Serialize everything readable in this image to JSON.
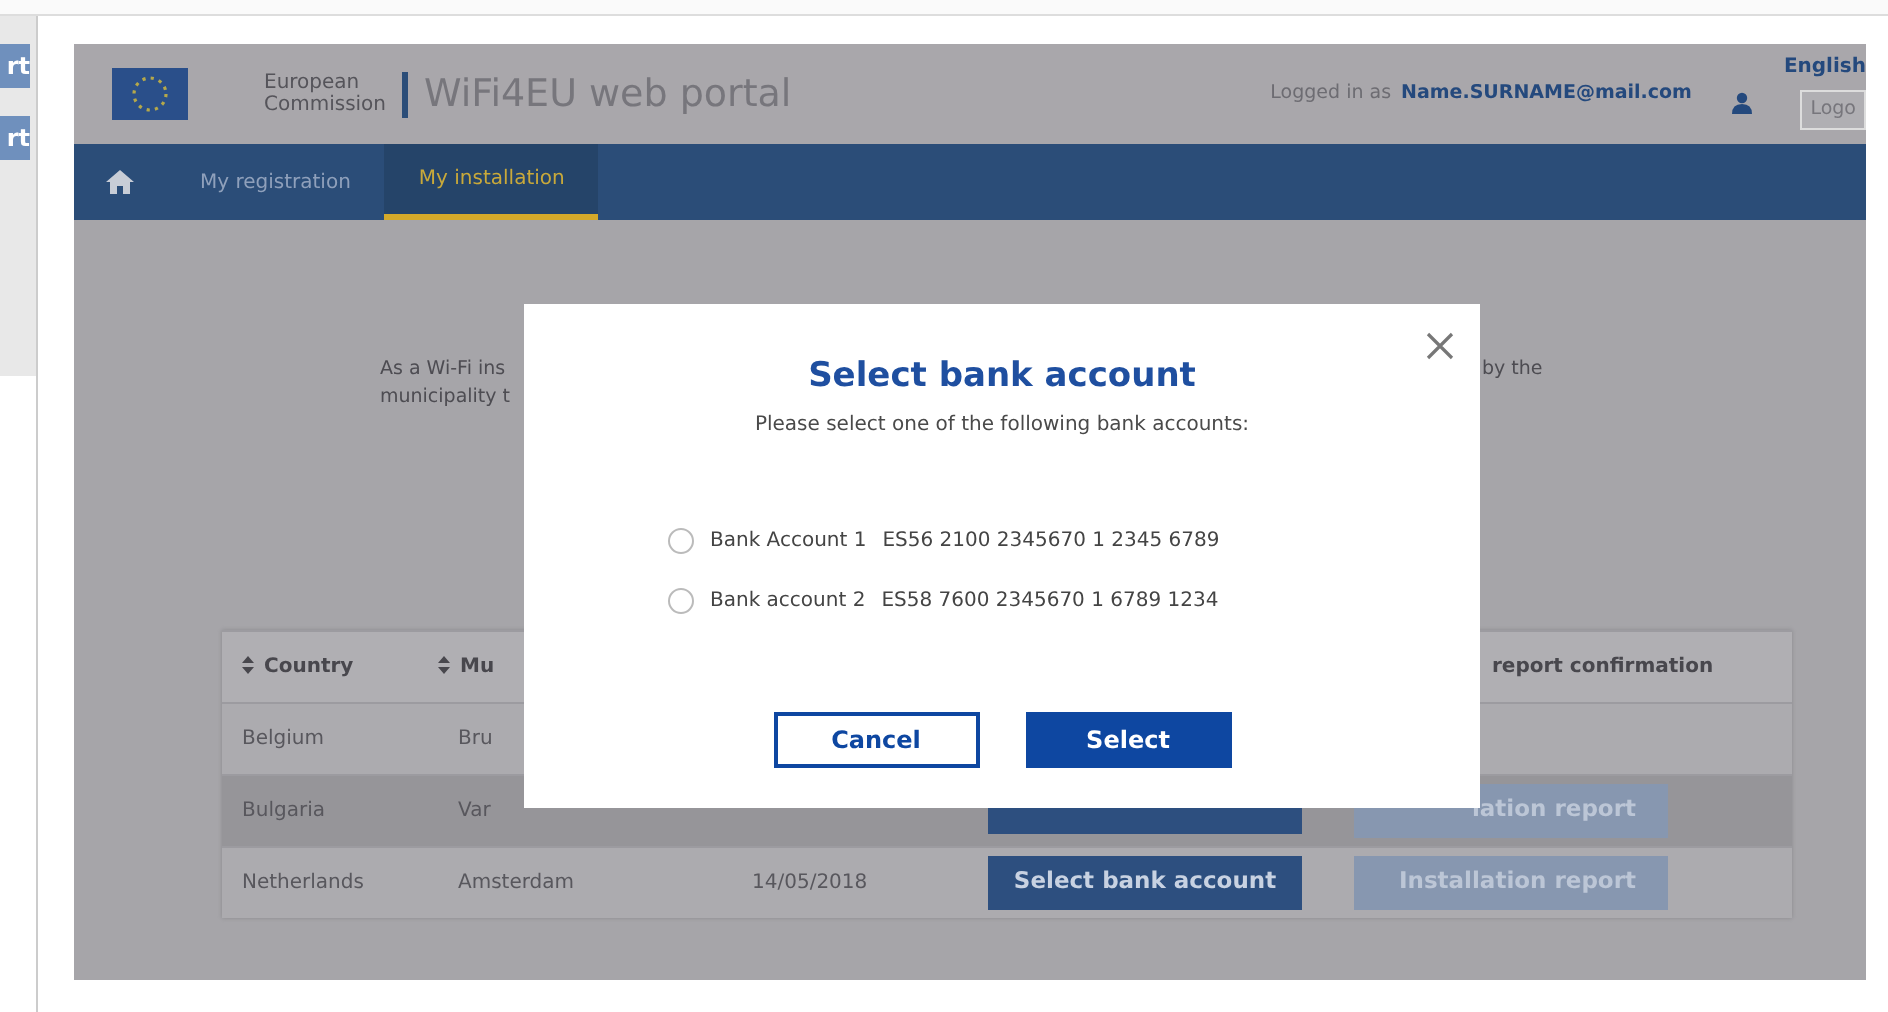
{
  "background_window": {
    "buttons": [
      "rt",
      "rt"
    ]
  },
  "header": {
    "organisation": "European Commission",
    "portal_title": "WiFi4EU web portal",
    "logged_in_label": "Logged in as",
    "user": "Name.SURNAME@mail.com",
    "language": "English",
    "logout": "Logo"
  },
  "nav": [
    {
      "kind": "home",
      "selected": false
    },
    {
      "kind": "link",
      "label": "My registration",
      "selected": false
    },
    {
      "kind": "link",
      "label": "My installation",
      "selected": true
    }
  ],
  "intro": {
    "lines": [
      "As a Wi-Fi ins",
      "municipality t"
    ],
    "right": "by the"
  },
  "table": {
    "columns": [
      {
        "label": "Country",
        "sortable": true
      },
      {
        "label": "Mu",
        "sortable": true
      },
      {
        "label": "report confirmation",
        "sortable": false
      }
    ],
    "rows": [
      {
        "country": "Belgium",
        "municipality": "Bru",
        "selected": false,
        "actions": []
      },
      {
        "country": "Bulgaria",
        "municipality": "Var",
        "selected": true,
        "actions": [
          {
            "kind": "select"
          },
          {
            "kind": "report",
            "label": "lation report"
          }
        ]
      },
      {
        "country": "Netherlands",
        "municipality": "Amsterdam",
        "date": "14/05/2018",
        "selected": false,
        "actions": [
          {
            "kind": "select",
            "label": "Select bank account"
          },
          {
            "kind": "report",
            "label": "Installation report"
          }
        ]
      }
    ]
  },
  "modal": {
    "title": "Select bank account",
    "subtitle": "Please select one of the following bank accounts:",
    "accounts": [
      {
        "label": "Bank Account 1",
        "iban": "ES56 2100 2345670 1 2345 6789",
        "selected": false
      },
      {
        "label": "Bank account 2",
        "iban": "ES58 7600 2345670 1 6789 1234",
        "selected": false
      }
    ],
    "buttons": [
      {
        "kind": "secondary",
        "label": "Cancel"
      },
      {
        "kind": "primary",
        "label": "Select"
      }
    ]
  }
}
